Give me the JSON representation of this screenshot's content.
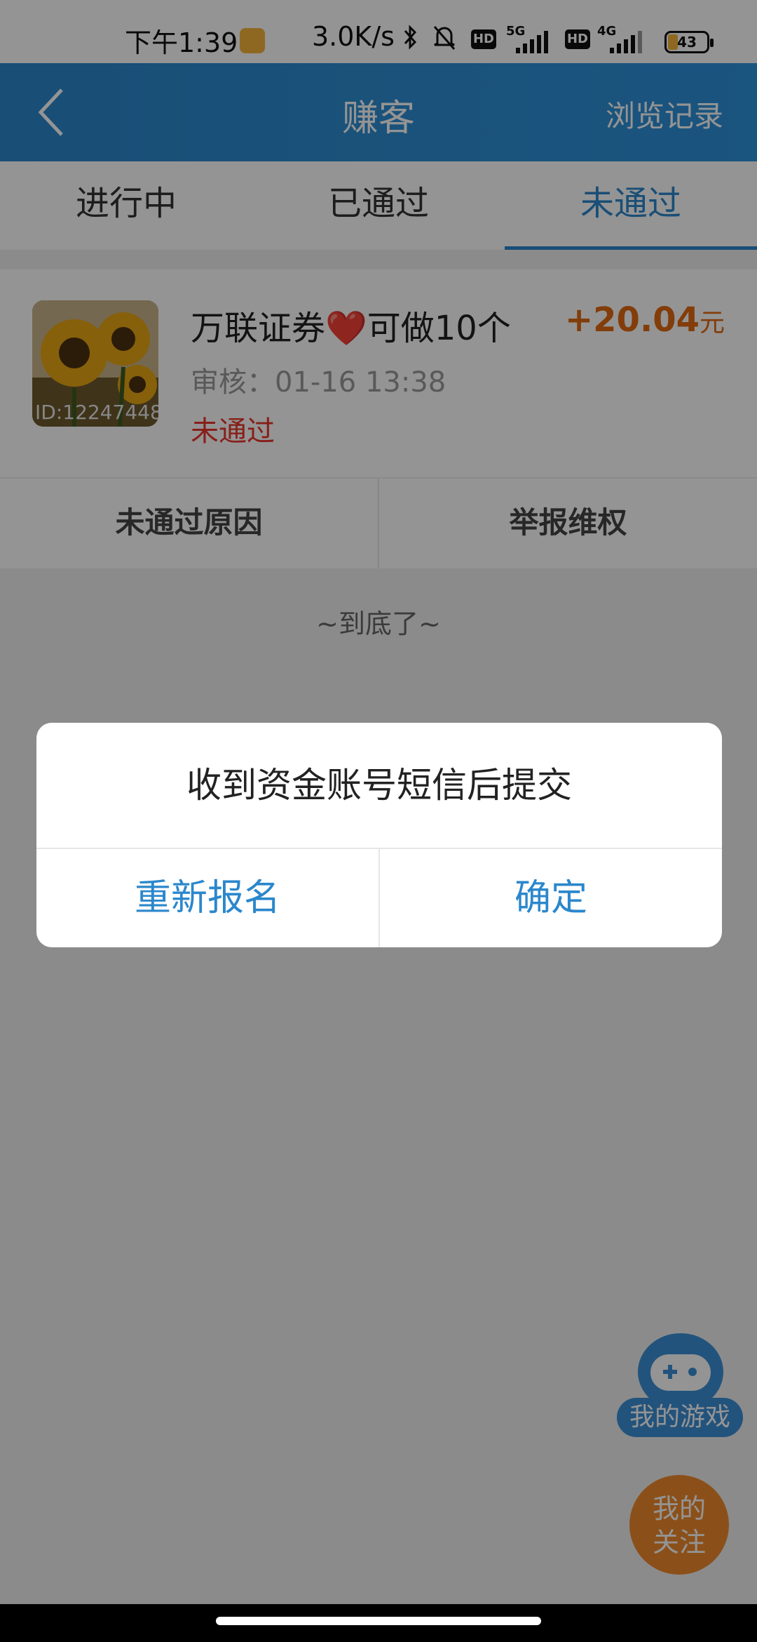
{
  "status_bar": {
    "time": "下午1:39",
    "speed": "3.0K/s",
    "battery": "43",
    "net1": "5G",
    "net2": "4G",
    "hd": "HD"
  },
  "header": {
    "title": "赚客",
    "right_link": "浏览记录"
  },
  "tabs": [
    {
      "label": "进行中",
      "active": false
    },
    {
      "label": "已通过",
      "active": false
    },
    {
      "label": "未通过",
      "active": true
    }
  ],
  "card": {
    "title": "万联证券❤️可做10个",
    "reward": "+20.04",
    "reward_unit": "元",
    "review_time": "审核：01-16 13:38",
    "status": "未通过",
    "image_id": "ID:12247448",
    "actions": [
      "未通过原因",
      "举报维权"
    ]
  },
  "list_end": "~到底了~",
  "floating": {
    "game_label": "我的游戏",
    "follow_label_line1": "我的",
    "follow_label_line2": "关注"
  },
  "dialog": {
    "message": "收到资金账号短信后提交",
    "left_button": "重新报名",
    "right_button": "确定"
  },
  "colors": {
    "accent": "#2b87cc",
    "reward": "#e06a12",
    "fail": "#e8362c",
    "follow": "#f08a2c"
  }
}
